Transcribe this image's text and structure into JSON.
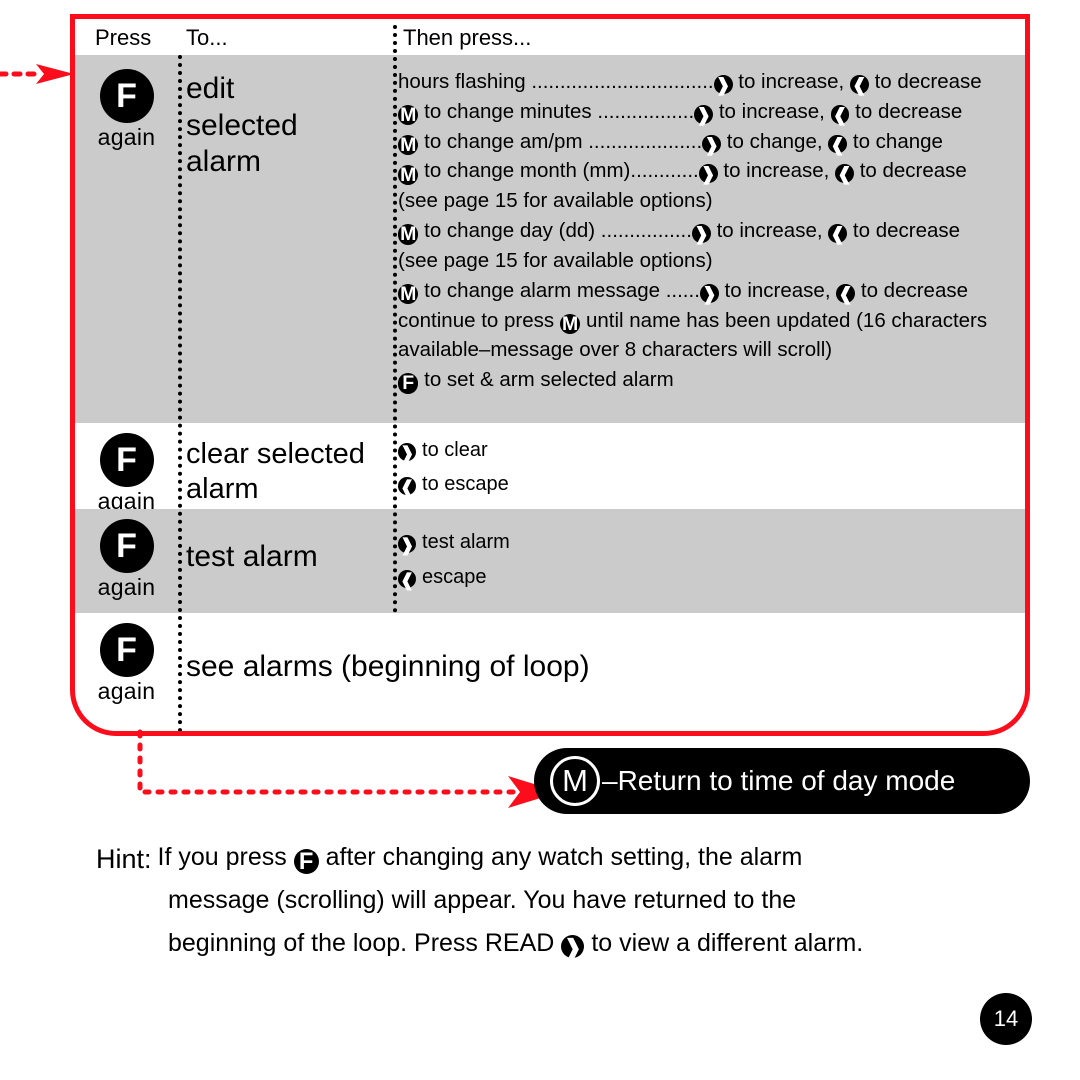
{
  "colors": {
    "accent_red": "#fb0d1b",
    "row_shade": "#cbcbcb",
    "ink": "#000000",
    "paper": "#ffffff"
  },
  "table": {
    "headers": {
      "press": "Press",
      "to": "To...",
      "then_press": "Then press..."
    },
    "rows": [
      {
        "press_button": "F",
        "press_note": "again",
        "to": [
          "edit",
          "selected",
          "alarm"
        ],
        "then": [
          {
            "pre": "hours flashing ",
            "leader": "................................",
            "mid": "to increase,",
            "post": "to decrease"
          },
          {
            "pre": "to change minutes ",
            "leader": ".................",
            "mid": "to increase,",
            "post": "to decrease"
          },
          {
            "pre": "to change am/pm ",
            "leader": "....................",
            "mid": "to change,",
            "post": "to change"
          },
          {
            "pre": "to change month (mm)",
            "leader": "............",
            "mid": "to increase,",
            "post": "to decrease"
          },
          {
            "plain": "(see page 15 for available options)"
          },
          {
            "pre": "to change day (dd) ",
            "leader": "................",
            "mid": "to increase,",
            "post": "to decrease"
          },
          {
            "plain": "(see page 15 for available options)"
          },
          {
            "pre": "to change alarm message ",
            "leader": "......",
            "mid": "to increase,",
            "post": "to decrease"
          },
          {
            "plain_mid_icon": true,
            "before": "continue to press ",
            "after": " until name has been updated (16 characters"
          },
          {
            "plain": "available–message over 8 characters will scroll)"
          },
          {
            "f_icon": true,
            "after": " to set & arm selected alarm"
          }
        ]
      },
      {
        "press_button": "F",
        "press_note": "again",
        "to": [
          "clear selected",
          "alarm"
        ],
        "then": [
          {
            "arrow": "right",
            "text": "to clear"
          },
          {
            "arrow": "left",
            "text": "to escape"
          }
        ]
      },
      {
        "press_button": "F",
        "press_note": "again",
        "to": [
          "test alarm"
        ],
        "then": [
          {
            "arrow": "right",
            "text": "test alarm"
          },
          {
            "arrow": "left",
            "text": "escape"
          }
        ]
      },
      {
        "press_button": "F",
        "press_note": "again",
        "to": [
          "see alarms (beginning of loop)"
        ],
        "then": []
      }
    ]
  },
  "return_pill": {
    "icon": "M",
    "text": "–Return to time of day mode"
  },
  "hint": {
    "label": "Hint:",
    "line1_a": "If you press",
    "line1_b": "after changing any watch setting, the alarm",
    "line2": "message (scrolling) will appear. You have returned to the",
    "line3_a": "beginning of the loop. Press READ",
    "line3_b": "to view a different alarm."
  },
  "page_number": "14",
  "icon_names": {
    "f_button": "f-button-icon",
    "m_button": "m-button-icon",
    "right_arrow": "right-arrow-icon",
    "left_arrow": "left-arrow-icon"
  }
}
